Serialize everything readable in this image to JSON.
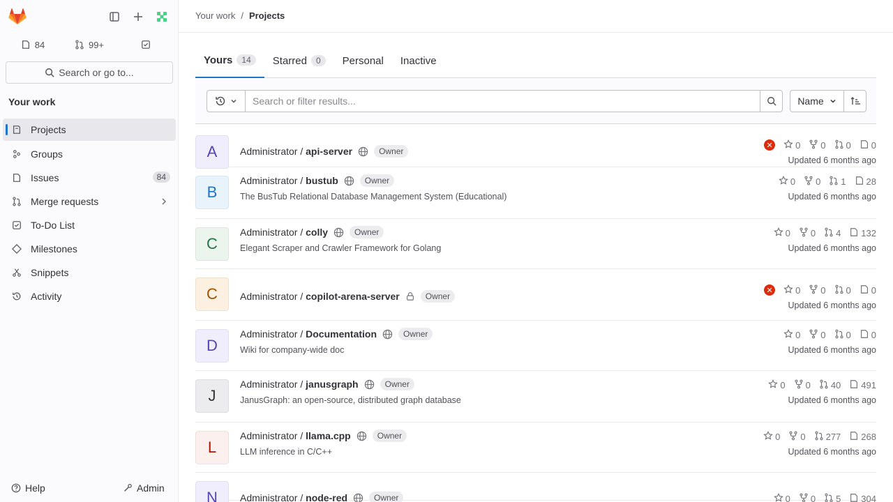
{
  "sidebar": {
    "counters": {
      "issues": "84",
      "merge_requests": "99+"
    },
    "search_label": "Search or go to...",
    "section_title": "Your work",
    "items": [
      {
        "label": "Projects",
        "icon": "project-icon"
      },
      {
        "label": "Groups",
        "icon": "group-icon"
      },
      {
        "label": "Issues",
        "icon": "issues-icon",
        "badge": "84"
      },
      {
        "label": "Merge requests",
        "icon": "merge-request-icon"
      },
      {
        "label": "To-Do List",
        "icon": "todo-icon"
      },
      {
        "label": "Milestones",
        "icon": "milestone-icon"
      },
      {
        "label": "Snippets",
        "icon": "snippet-icon"
      },
      {
        "label": "Activity",
        "icon": "history-icon"
      }
    ],
    "help_label": "Help",
    "admin_label": "Admin"
  },
  "breadcrumb": {
    "parent": "Your work",
    "current": "Projects"
  },
  "tabs": [
    {
      "label": "Yours",
      "count": "14"
    },
    {
      "label": "Starred",
      "count": "0"
    },
    {
      "label": "Personal"
    },
    {
      "label": "Inactive"
    }
  ],
  "filter": {
    "placeholder": "Search or filter results...",
    "sort_label": "Name"
  },
  "projects": [
    {
      "avatar": "A",
      "avatar_bg": "#f0eefc",
      "avatar_fg": "#5943b6",
      "namespace": "Administrator / ",
      "name": "api-server",
      "visibility": "public",
      "role": "Owner",
      "description": "",
      "pipeline_failed": true,
      "stars": "0",
      "forks": "0",
      "merge_requests": "0",
      "issues": "0",
      "updated": "Updated 6 months ago"
    },
    {
      "avatar": "B",
      "avatar_bg": "#e9f3fc",
      "avatar_fg": "#1f75cb",
      "namespace": "Administrator / ",
      "name": "bustub",
      "visibility": "public",
      "role": "Owner",
      "description": "The BusTub Relational Database Management System (Educational)",
      "pipeline_failed": false,
      "stars": "0",
      "forks": "0",
      "merge_requests": "1",
      "issues": "28",
      "updated": "Updated 6 months ago"
    },
    {
      "avatar": "C",
      "avatar_bg": "#ecf4ee",
      "avatar_fg": "#217645",
      "namespace": "Administrator / ",
      "name": "colly",
      "visibility": "public",
      "role": "Owner",
      "description": "Elegant Scraper and Crawler Framework for Golang",
      "pipeline_failed": false,
      "stars": "0",
      "forks": "0",
      "merge_requests": "4",
      "issues": "132",
      "updated": "Updated 6 months ago"
    },
    {
      "avatar": "C",
      "avatar_bg": "#fcf1e0",
      "avatar_fg": "#9e5400",
      "namespace": "Administrator / ",
      "name": "copilot-arena-server",
      "visibility": "private",
      "role": "Owner",
      "description": "",
      "pipeline_failed": true,
      "stars": "0",
      "forks": "0",
      "merge_requests": "0",
      "issues": "0",
      "updated": "Updated 6 months ago"
    },
    {
      "avatar": "D",
      "avatar_bg": "#f0eefc",
      "avatar_fg": "#5943b6",
      "namespace": "Administrator / ",
      "name": "Documentation",
      "visibility": "public",
      "role": "Owner",
      "description": "Wiki for company-wide doc",
      "pipeline_failed": false,
      "stars": "0",
      "forks": "0",
      "merge_requests": "0",
      "issues": "0",
      "updated": "Updated 6 months ago"
    },
    {
      "avatar": "J",
      "avatar_bg": "#ececef",
      "avatar_fg": "#333238",
      "namespace": "Administrator / ",
      "name": "janusgraph",
      "visibility": "public",
      "role": "Owner",
      "description": "JanusGraph: an open-source, distributed graph database",
      "pipeline_failed": false,
      "stars": "0",
      "forks": "0",
      "merge_requests": "40",
      "issues": "491",
      "updated": "Updated 6 months ago"
    },
    {
      "avatar": "L",
      "avatar_bg": "#fcf0ef",
      "avatar_fg": "#ae1800",
      "namespace": "Administrator / ",
      "name": "llama.cpp",
      "visibility": "public",
      "role": "Owner",
      "description": "LLM inference in C/C++",
      "pipeline_failed": false,
      "stars": "0",
      "forks": "0",
      "merge_requests": "277",
      "issues": "268",
      "updated": "Updated 6 months ago"
    },
    {
      "avatar": "N",
      "avatar_bg": "#f0eefc",
      "avatar_fg": "#5943b6",
      "namespace": "Administrator / ",
      "name": "node-red",
      "visibility": "public",
      "role": "Owner",
      "description": "",
      "pipeline_failed": false,
      "stars": "0",
      "forks": "0",
      "merge_requests": "5",
      "issues": "304",
      "updated": ""
    }
  ],
  "colors": {
    "accent": "#1f75cb",
    "danger": "#dd2b0e",
    "sidebar_bg": "#fbfafd"
  }
}
